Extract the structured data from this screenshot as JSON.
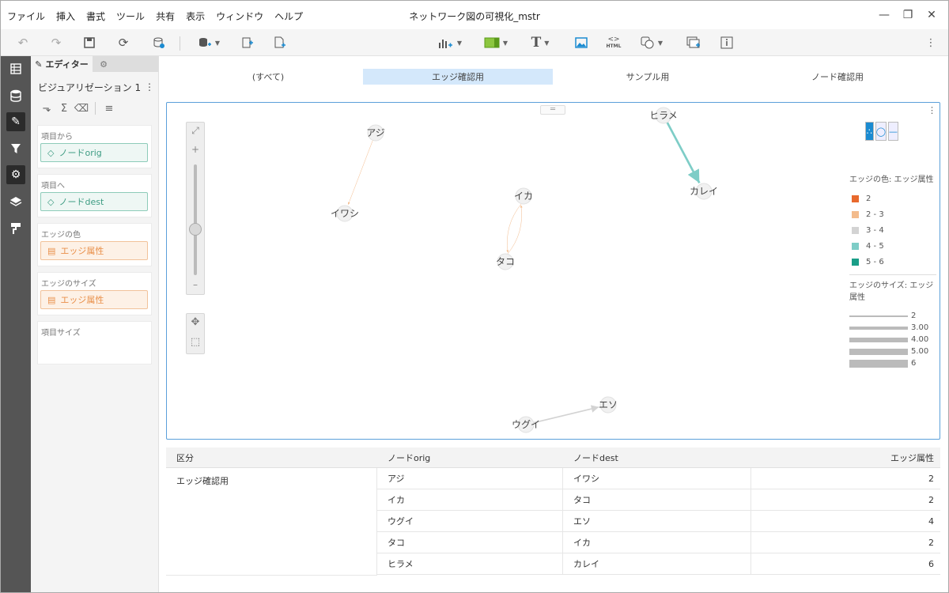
{
  "window": {
    "title": "ネットワーク図の可視化_mstr",
    "menu": [
      "ファイル",
      "挿入",
      "書式",
      "ツール",
      "共有",
      "表示",
      "ウィンドウ",
      "ヘルプ"
    ],
    "controls": [
      "minimize-icon",
      "restore-icon",
      "close-icon"
    ]
  },
  "toolbar": {
    "icons": [
      "undo-icon",
      "redo-icon",
      "save-icon",
      "refresh-icon",
      "data-source-icon",
      "add-dataset-icon",
      "duplicate-page-icon",
      "new-page-icon",
      "insert-visualization-icon",
      "insert-filter-icon",
      "text-icon",
      "image-icon",
      "html-icon",
      "shape-icon",
      "panel-stack-icon",
      "info-window-icon",
      "more-icon"
    ],
    "html_label": "HTML",
    "text_label": "T"
  },
  "rail": {
    "icons": [
      "dataset-icon",
      "database-icon",
      "editor-icon",
      "filter-icon",
      "properties-icon",
      "layers-icon",
      "format-icon"
    ]
  },
  "editor": {
    "tab_editor": "エディター",
    "viz_name": "ビジュアリゼーション 1",
    "zones": [
      {
        "title": "項目から",
        "item": "ノードorig",
        "kind": "attr"
      },
      {
        "title": "項目へ",
        "item": "ノードdest",
        "kind": "attr"
      },
      {
        "title": "エッジの色",
        "item": "エッジ属性",
        "kind": "metric"
      },
      {
        "title": "エッジのサイズ",
        "item": "エッジ属性",
        "kind": "metric"
      },
      {
        "title": "項目サイズ",
        "item": "",
        "kind": "empty"
      }
    ]
  },
  "selector": {
    "items": [
      "(すべて)",
      "エッジ確認用",
      "サンプル用",
      "ノード確認用"
    ],
    "selected": "エッジ確認用"
  },
  "network": {
    "nodes": [
      "アジ",
      "イワシ",
      "イカ",
      "タコ",
      "ヒラメ",
      "カレイ",
      "ウグイ",
      "エソ"
    ],
    "edges": [
      {
        "from": "アジ",
        "to": "イワシ",
        "value": 2,
        "color": "#f3bb8c"
      },
      {
        "from": "イカ",
        "to": "タコ",
        "value": 2,
        "color": "#f3bb8c"
      },
      {
        "from": "タコ",
        "to": "イカ",
        "value": 2,
        "color": "#f3bb8c"
      },
      {
        "from": "ヒラメ",
        "to": "カレイ",
        "value": 6,
        "color": "#7ecdc7"
      },
      {
        "from": "ウグイ",
        "to": "エソ",
        "value": 4,
        "color": "#d3d3d3"
      }
    ]
  },
  "legend": {
    "color_title": "エッジの色: エッジ属性",
    "color_items": [
      {
        "label": "2",
        "color": "#e8692d"
      },
      {
        "label": "2 - 3",
        "color": "#f3bb8c"
      },
      {
        "label": "3 - 4",
        "color": "#d3d3d3"
      },
      {
        "label": "4 - 5",
        "color": "#7ecdc7"
      },
      {
        "label": "5 - 6",
        "color": "#1a9e88"
      }
    ],
    "size_title": "エッジのサイズ: エッジ属性",
    "size_items": [
      "2",
      "3.00",
      "4.00",
      "5.00",
      "6"
    ]
  },
  "zoom": {
    "level": 0.4
  },
  "grid": {
    "headers": [
      "区分",
      "ノードorig",
      "ノードdest",
      "エッジ属性"
    ],
    "group": "エッジ確認用",
    "rows": [
      [
        "アジ",
        "イワシ",
        "2"
      ],
      [
        "イカ",
        "タコ",
        "2"
      ],
      [
        "ウグイ",
        "エソ",
        "4"
      ],
      [
        "タコ",
        "イカ",
        "2"
      ],
      [
        "ヒラメ",
        "カレイ",
        "6"
      ]
    ]
  }
}
